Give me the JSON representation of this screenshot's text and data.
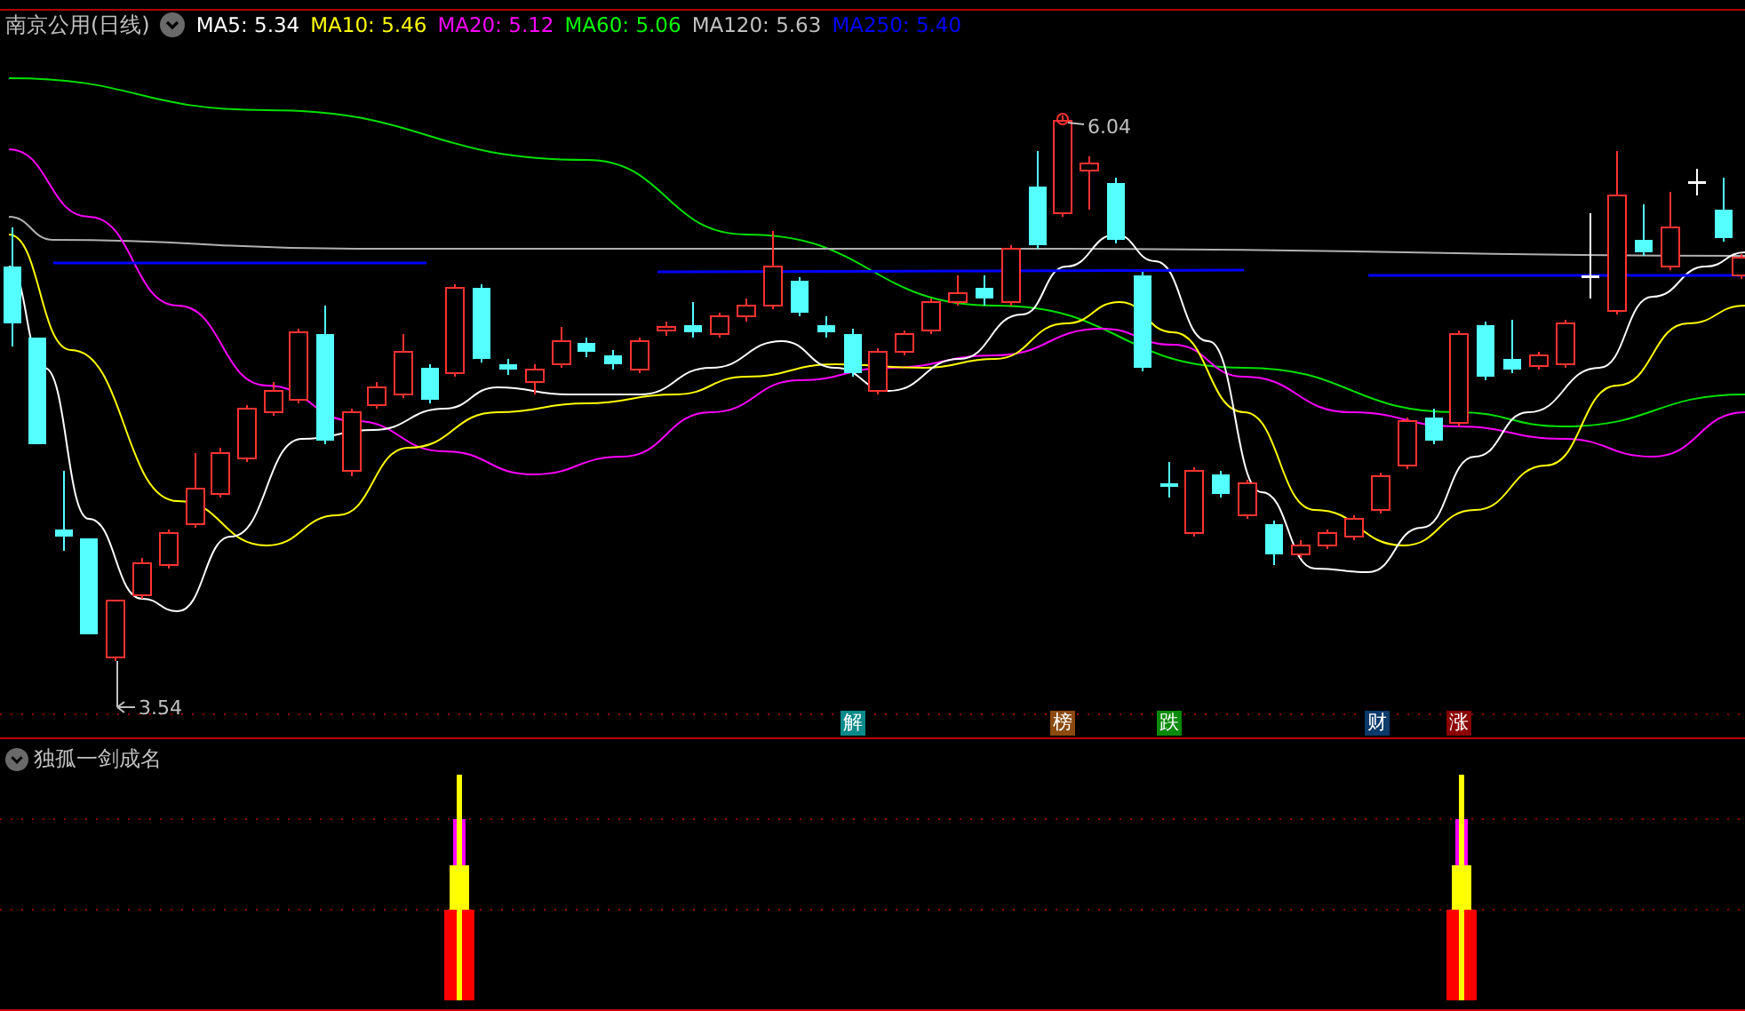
{
  "header": {
    "title": "南京公用(日线)",
    "indicators": [
      {
        "label": "MA5: 5.34",
        "color": "#ffffff"
      },
      {
        "label": "MA10: 5.46",
        "color": "#ffff00"
      },
      {
        "label": "MA20: 5.12",
        "color": "#ff00ff"
      },
      {
        "label": "MA60: 5.06",
        "color": "#00ff00"
      },
      {
        "label": "MA120: 5.63",
        "color": "#c0c0c0"
      },
      {
        "label": "MA250: 5.40",
        "color": "#0000ff"
      }
    ]
  },
  "chart": {
    "high_label": "6.04",
    "low_label": "3.54",
    "events": [
      {
        "label": "解",
        "color": "#0a8a8a"
      },
      {
        "label": "榜",
        "color": "#8b4a10"
      },
      {
        "label": "跌",
        "color": "#0a8a0a"
      },
      {
        "label": "财",
        "color": "#0b3a6b"
      },
      {
        "label": "涨",
        "color": "#8b0000"
      }
    ]
  },
  "indicator_panel": {
    "title": "独孤一剑成名"
  }
}
